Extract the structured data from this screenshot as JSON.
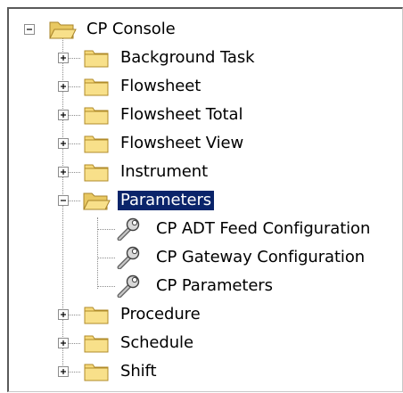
{
  "tree": {
    "root": {
      "label": "CP Console",
      "expanded": true,
      "icon": "folder-open-icon"
    },
    "children": [
      {
        "label": "Background Task",
        "expanded": false,
        "icon": "folder-icon"
      },
      {
        "label": "Flowsheet",
        "expanded": false,
        "icon": "folder-icon"
      },
      {
        "label": "Flowsheet Total",
        "expanded": false,
        "icon": "folder-icon"
      },
      {
        "label": "Flowsheet View",
        "expanded": false,
        "icon": "folder-icon"
      },
      {
        "label": "Instrument",
        "expanded": false,
        "icon": "folder-icon"
      },
      {
        "label": "Parameters",
        "expanded": true,
        "selected": true,
        "icon": "folder-open-icon",
        "children": [
          {
            "label": "CP ADT Feed Configuration",
            "icon": "wrench-icon"
          },
          {
            "label": "CP Gateway Configuration",
            "icon": "wrench-icon"
          },
          {
            "label": "CP Parameters",
            "icon": "wrench-icon"
          }
        ]
      },
      {
        "label": "Procedure",
        "expanded": false,
        "icon": "folder-icon"
      },
      {
        "label": "Schedule",
        "expanded": false,
        "icon": "folder-icon"
      },
      {
        "label": "Shift",
        "expanded": false,
        "icon": "folder-icon"
      }
    ]
  },
  "colors": {
    "selection_bg": "#0a246a",
    "selection_fg": "#ffffff",
    "folder_fill": "#f6d97a",
    "folder_stroke": "#b08b2a",
    "connector": "#8c8c8c"
  }
}
